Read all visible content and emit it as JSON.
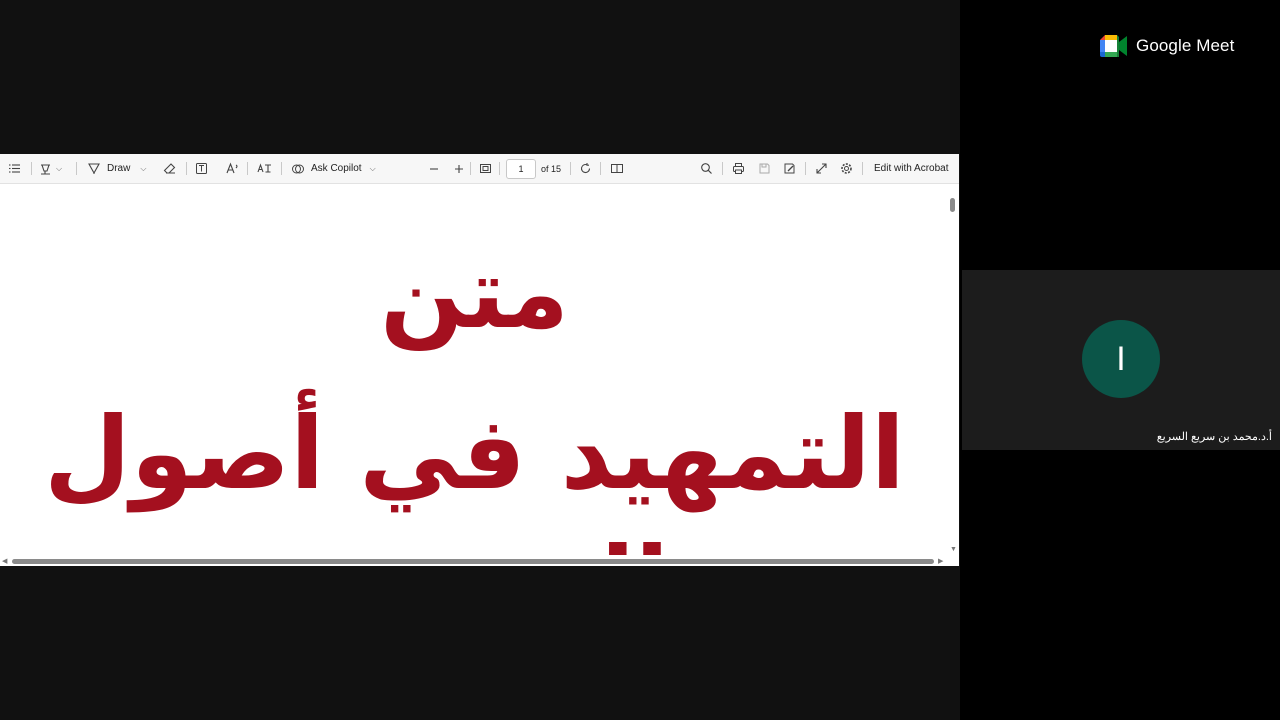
{
  "toolbar": {
    "draw_label": "Draw",
    "ask_copilot_label": "Ask Copilot",
    "page_number": "1",
    "page_total": "of 15",
    "edit_acrobat_label": "Edit with Acrobat"
  },
  "document": {
    "title_line1": "متن",
    "title_line2": "التمهيد في أصول التفسير",
    "text_color": "#a4101f"
  },
  "meet": {
    "brand": "Google Meet",
    "participant_initial": "I",
    "participant_name": "أ.د.محمد بن سريع السريع",
    "avatar_color": "#0b5548"
  }
}
